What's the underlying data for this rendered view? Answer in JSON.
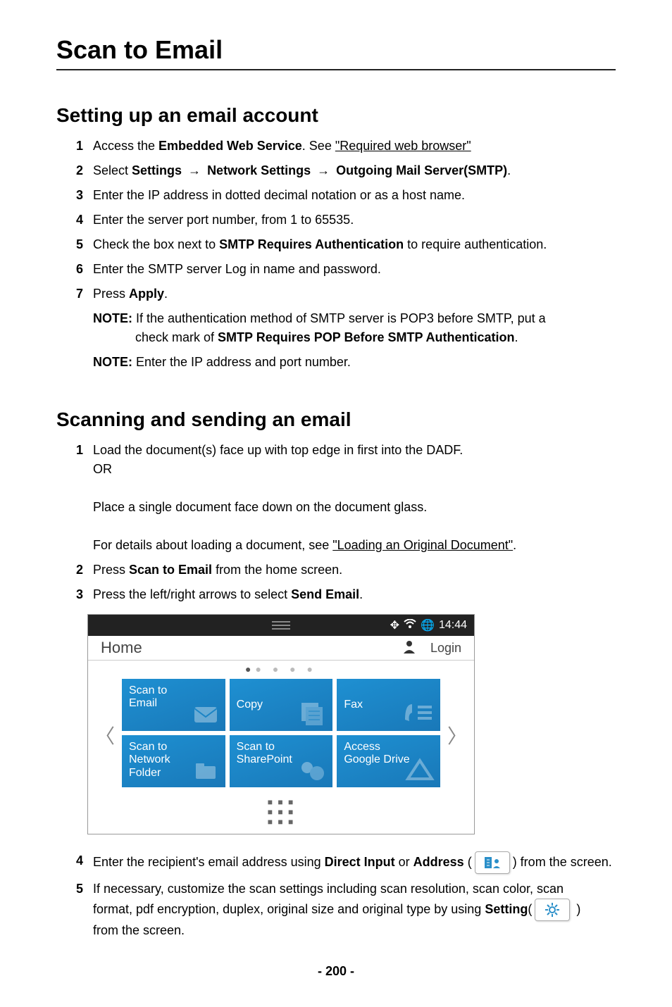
{
  "title": "Scan to Email",
  "section1": {
    "heading": "Setting up an email account",
    "items": {
      "s1_pre": "Access the ",
      "s1_bold": "Embedded Web Service",
      "s1_mid": ". See ",
      "s1_link": "\"Required web browser\"",
      "s2_pre": "Select ",
      "s2_b1": "Settings",
      "s2_b2": "Network Settings",
      "s2_b3": "Outgoing Mail Server(SMTP)",
      "s3": "Enter the IP address in dotted decimal notation or as a host name.",
      "s4": "Enter the server port number, from 1 to 65535.",
      "s5_pre": "Check the box next to ",
      "s5_bold": "SMTP Requires Authentication",
      "s5_post": " to require authentication.",
      "s6": "Enter the SMTP server Log in name and password.",
      "s7_pre": "Press ",
      "s7_bold": "Apply",
      "note1_label": "NOTE:",
      "note1_a": " If the authentication method of SMTP server is POP3 before SMTP, put a",
      "note1_b": "check mark of ",
      "note1_bold": "SMTP Requires POP Before SMTP Authentication",
      "note2_label": "NOTE:",
      "note2": " Enter the IP address and port number."
    }
  },
  "section2": {
    "heading": "Scanning and sending an email",
    "s1_a": "Load the document(s) face up with top edge in first into the DADF.",
    "s1_or": "OR",
    "s1_b": "Place a single document face down on the document glass.",
    "s1_c_pre": "For details about loading a document, see ",
    "s1_c_link": "\"Loading an Original Document\"",
    "s2_pre": "Press ",
    "s2_bold": "Scan to Email",
    "s2_post": " from the home screen.",
    "s3_pre": "Press the left/right arrows to select ",
    "s3_bold": "Send Email",
    "s4_pre": "Enter the recipient's email address using ",
    "s4_b1": "Direct Input",
    "s4_mid": " or ",
    "s4_b2": "Address",
    "s4_post": ") from the screen.",
    "s5_a": "If necessary, customize the scan settings including scan resolution, scan color, scan",
    "s5_b_pre": "format, pdf encryption, duplex, original size and original type by using ",
    "s5_b_bold": "Setting",
    "s5_c": "from the screen."
  },
  "screenshot": {
    "time": "14:44",
    "home": "Home",
    "login": "Login",
    "tiles": {
      "t1": "Scan to\nEmail",
      "t2": "Copy",
      "t3": "Fax",
      "t4": "Scan to\nNetwork\nFolder",
      "t5": "Scan to\nSharePoint",
      "t6": "Access\nGoogle Drive"
    }
  },
  "page_number": "200"
}
